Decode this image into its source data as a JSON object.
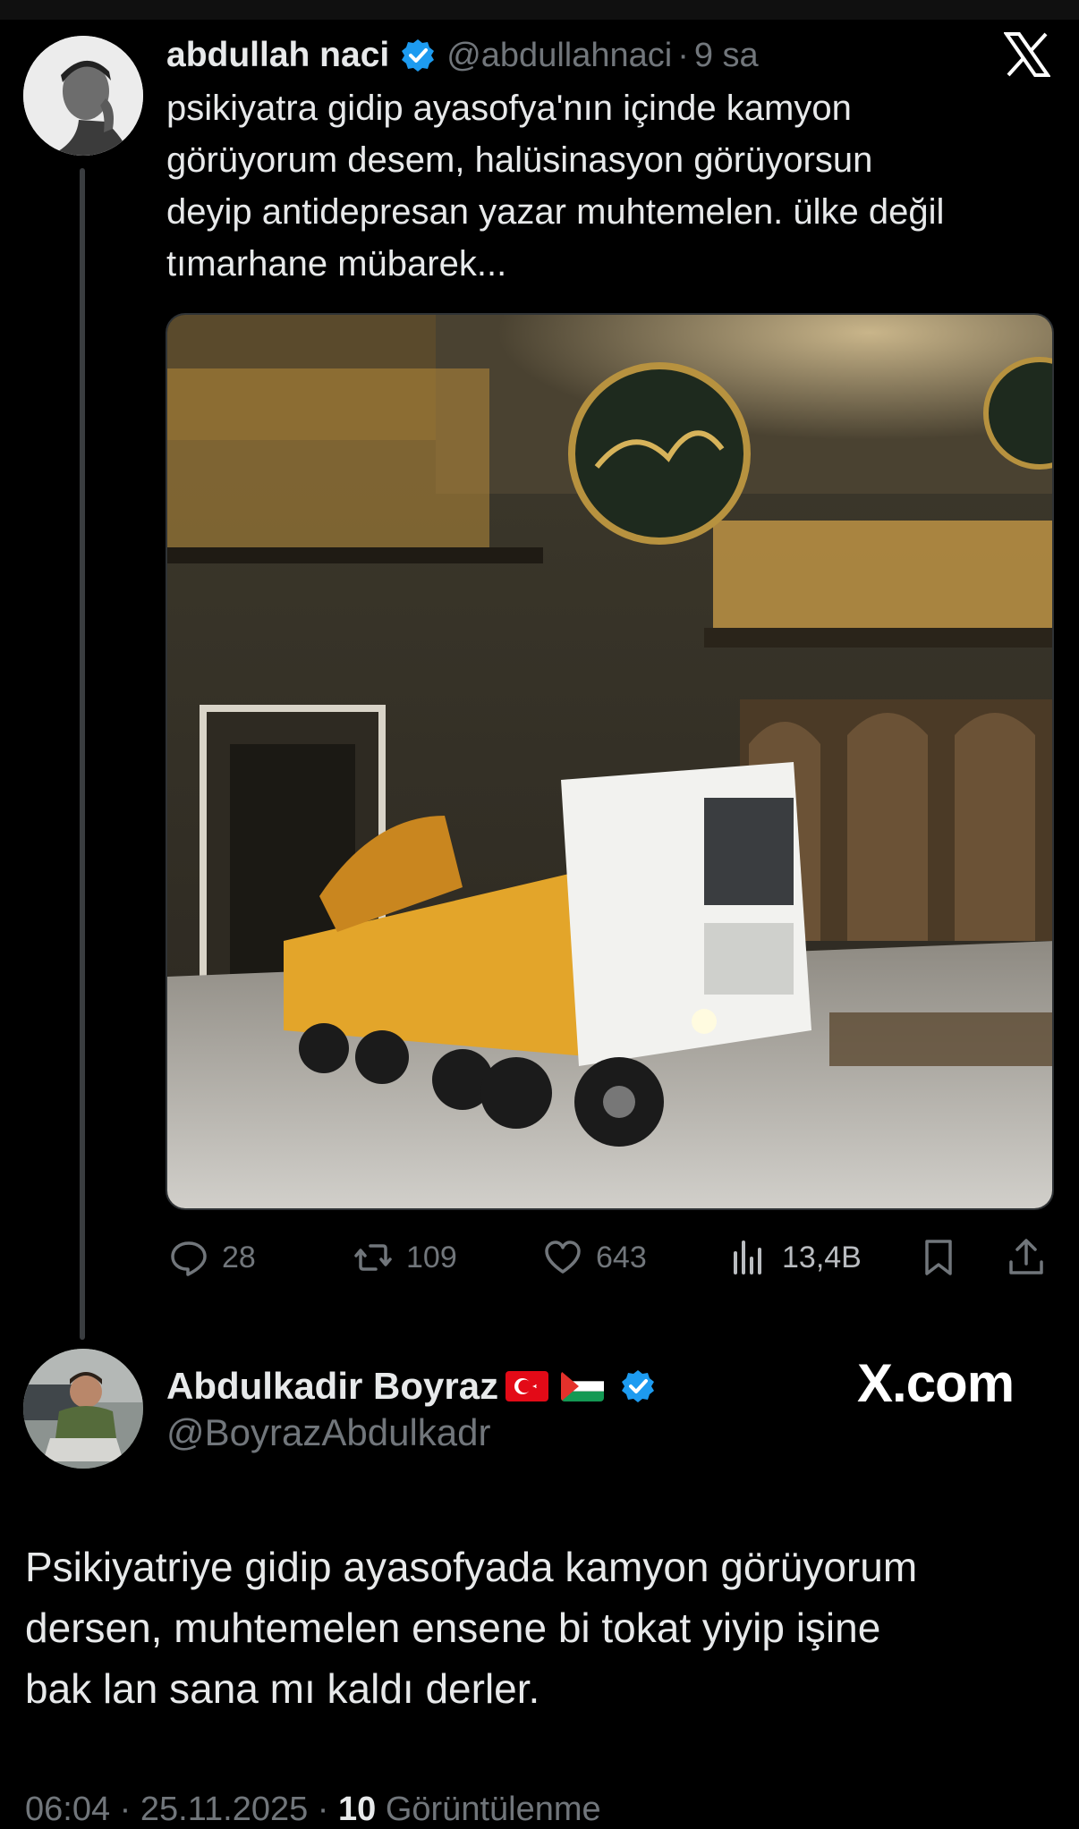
{
  "quoted_tweet": {
    "display_name": "abdullah naci",
    "handle": "@abdullahnaci",
    "separator": "·",
    "time": "9 sa",
    "text": "psikiyatra gidip ayasofya'nın içinde kamyon\ngörüyorum desem, halüsinasyon görüyorsun\ndeyip antidepresan yazar muhtemelen. ülke değil\ntımarhane mübarek...",
    "actions": {
      "replies": "28",
      "reposts": "109",
      "likes": "643",
      "views": "13,4B"
    }
  },
  "main_tweet": {
    "display_name": "Abdulkadir Boyraz",
    "handle": "@BoyrazAbdulkadr",
    "watermark": "X.com",
    "text": "Psikiyatriye gidip ayasofyada kamyon görüyorum\ndersen, muhtemelen ensene bi tokat yiyip işine\nbak lan sana mı kaldı derler.",
    "timestamp": "06:04 · 25.11.2025 · ",
    "views_count": "10",
    "views_label": " Görüntülenme"
  },
  "colors": {
    "background": "#000000",
    "text": "#e7e9ea",
    "muted": "#71767b",
    "verified": "#1d9bf0"
  }
}
